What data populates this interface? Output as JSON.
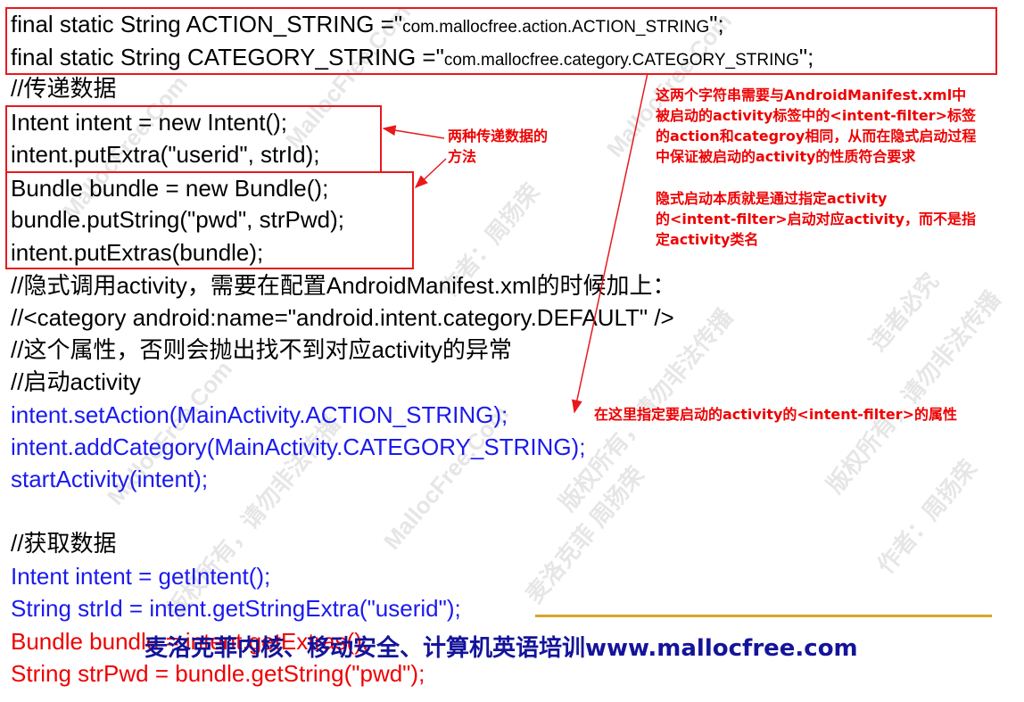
{
  "code": {
    "line1": {
      "prefix": "final static String ACTION_STRING =\"",
      "value": "com.mallocfree.action.ACTION_STRING",
      "suffix": "\";"
    },
    "line2": {
      "prefix": "final static String CATEGORY_STRING =\"",
      "value": "com.mallocfree.category.CATEGORY_STRING",
      "suffix": "\";"
    },
    "comment_pass": "//传递数据",
    "intent_new": "Intent intent = new Intent();",
    "put_extra": "intent.putExtra(\"userid\", strId);",
    "bundle_new": "Bundle bundle = new Bundle();",
    "put_string": "bundle.putString(\"pwd\",  strPwd);",
    "put_extras": "intent.putExtras(bundle);",
    "comment_implicit": "//隐式调用activity，需要在配置AndroidManifest.xml的时候加上：",
    "comment_category": "//<category android:name=\"android.intent.category.DEFAULT\" />",
    "comment_exception": "//这个属性，否则会抛出找不到对应activity的异常",
    "comment_start": "//启动activity",
    "set_action": "intent.setAction(MainActivity.ACTION_STRING);",
    "add_category": "intent.addCategory(MainActivity.CATEGORY_STRING);",
    "start_activity": "startActivity(intent);",
    "comment_get": "//获取数据",
    "get_intent": "Intent intent = getIntent();",
    "get_string_extra": "String strId = intent.getStringExtra(\"userid\");",
    "get_extras": "Bundle bundle = intent.getExtras();",
    "get_pwd": "String strPwd = bundle.getString(\"pwd\");"
  },
  "annotations": {
    "two_ways_line1": "两种传递数据的",
    "two_ways_line2": "方法",
    "manifest_note": [
      "这两个字符串需要与AndroidManifest.xml中",
      "被启动的activity标签中的<intent-filter>标签",
      "的action和categroy相同，从而在隐式启动过程",
      "中保证被启动的activity的性质符合要求"
    ],
    "implicit_note": [
      "隐式启动本质就是通过指定activity",
      "的<intent-filter>启动对应activity，而不是指",
      "定activity类名"
    ],
    "set_here": "在这里指定要启动的activity的<intent-filter>的属性"
  },
  "footer": "麦洛克菲内核、移动安全、计算机英语培训www.mallocfree.com",
  "watermarks": [
    "MallocFree.Com",
    "版权所有，请勿非法传播",
    "作者：周扬荣",
    "麦洛克菲 周扬荣",
    "违者必究"
  ],
  "colors": {
    "code": "#000000",
    "blue_code": "#1a1aee",
    "red_code": "#ee0000",
    "annotation": "#ee0000",
    "box": "#e8191d",
    "footer": "#14149a",
    "rule": "#d7a527"
  }
}
